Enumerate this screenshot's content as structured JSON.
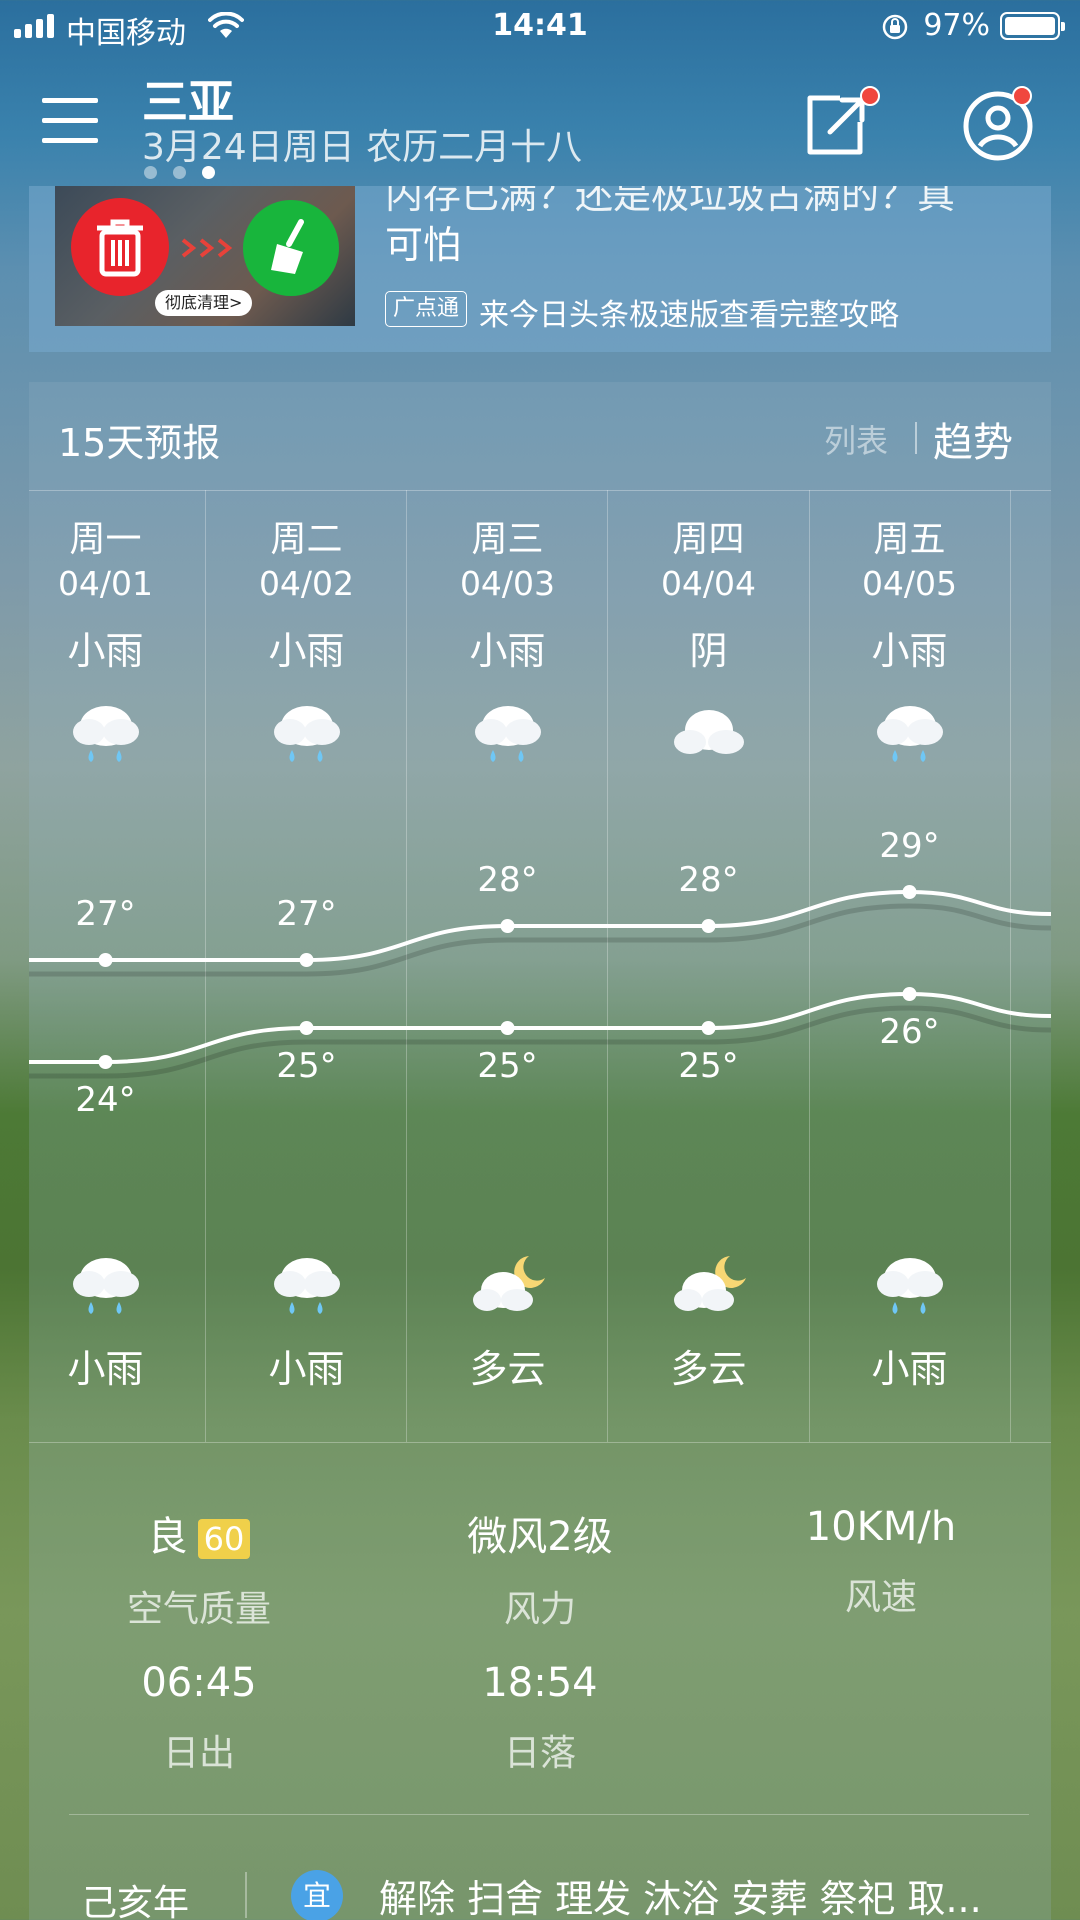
{
  "status_bar": {
    "carrier": "中国移动",
    "time": "14:41",
    "battery_percent": "97%"
  },
  "header": {
    "city": "三亚",
    "date_line": "3月24日周日  农历二月十八",
    "page_count": 3,
    "active_page": 3
  },
  "ad": {
    "title_partial": "内存已满？还是极垃圾占满的？真可怕",
    "title_visible_line2": "可怕",
    "thumb_button": "彻底清理>",
    "badge": "广点通",
    "link_text": "来今日头条极速版查看完整攻略"
  },
  "forecast": {
    "title": "15天预报",
    "toggle_list": "列表",
    "toggle_trend": "趋势",
    "days": [
      {
        "weekday": "周一",
        "date": "04/01",
        "day_cond": "小雨",
        "day_icon": "rain-cloud-icon",
        "high": "27°",
        "low": "24°",
        "night_cond": "小雨",
        "night_icon": "rain-cloud-icon"
      },
      {
        "weekday": "周二",
        "date": "04/02",
        "day_cond": "小雨",
        "day_icon": "rain-cloud-icon",
        "high": "27°",
        "low": "25°",
        "night_cond": "小雨",
        "night_icon": "rain-cloud-icon"
      },
      {
        "weekday": "周三",
        "date": "04/03",
        "day_cond": "小雨",
        "day_icon": "rain-cloud-icon",
        "high": "28°",
        "low": "25°",
        "night_cond": "多云",
        "night_icon": "cloud-moon-icon"
      },
      {
        "weekday": "周四",
        "date": "04/04",
        "day_cond": "阴",
        "day_icon": "overcast-cloud-icon",
        "high": "28°",
        "low": "25°",
        "night_cond": "多云",
        "night_icon": "cloud-moon-icon"
      },
      {
        "weekday": "周五",
        "date": "04/05",
        "day_cond": "小雨",
        "day_icon": "rain-cloud-icon",
        "high": "29°",
        "low": "26°",
        "night_cond": "小雨",
        "night_icon": "rain-cloud-icon"
      }
    ]
  },
  "chart_data": {
    "type": "line",
    "categories": [
      "04/01",
      "04/02",
      "04/03",
      "04/04",
      "04/05"
    ],
    "series": [
      {
        "values": [
          27,
          27,
          28,
          28,
          29
        ]
      },
      {
        "values": [
          24,
          25,
          25,
          25,
          26
        ]
      }
    ]
  },
  "stats": {
    "air_quality_value": "良",
    "air_quality_index": "60",
    "air_quality_label": "空气质量",
    "wind_level_value": "微风2级",
    "wind_level_label": "风力",
    "wind_speed_value": "10KM/h",
    "wind_speed_label": "风速",
    "sunrise_value": "06:45",
    "sunrise_label": "日出",
    "sunset_value": "18:54",
    "sunset_label": "日落"
  },
  "almanac": {
    "year": "己亥年",
    "yi_badge": "宜",
    "items": "解除 扫舍 理发 沐浴 安葬 祭祀 取..."
  },
  "colors": {
    "notification_dot": "#f0473e",
    "aqi_badge": "#f0d04a",
    "yi_badge": "#4aa2e6"
  }
}
